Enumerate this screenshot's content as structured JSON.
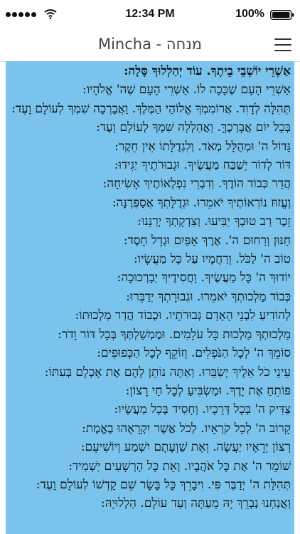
{
  "status_bar": {
    "time": "12:34 PM",
    "battery": "100%"
  },
  "nav": {
    "title": "Mincha - מנחה"
  },
  "prayer": {
    "lines": [
      "אַשְׁרֵי יוֹשְׁבֵי בֵיתֶךָ. עוֹד יְהַלְלוּךָ סֶּלָה:",
      "אַשְׁרֵי הָעָם שֶׁכָּכָה לוֹ. אַשְׁרֵי הָעָם שֶׁה' אֱלֹהָיו:",
      "תְּהִלָּה לְדָוִד. אֲרוֹמִמְךָ אֱלוֹהַי הַמֶּלֶךְ. וַאֲבָרְכָה שִׁמְךָ לְעוֹלָם וָעֶד:",
      "בְּכָל יוֹם אֲבָרְכֶךָּ. וַאֲהַלְלָה שִׁמְךָ לְעוֹלָם וָעֶד:",
      "גָּדוֹל ה' וּמְהֻלָּל מְאֹד. וְלִגְדֻלָּתוֹ אֵין חֵקֶר:",
      "דּוֹר לְדוֹר יְשַׁבַּח מַעֲשֶׂיךָ. וּגְבוּרֹתֶיךָ יַגִּידוּ:",
      "הֲדַר כְּבוֹד הוֹדֶךָ. וְדִבְרֵי נִפְלְאוֹתֶיךָ אָשִׂיחָה:",
      "וֶעֱזוּז נוֹרְאוֹתֶיךָ יֹאמֵרוּ. וּגְדֻלָּתְךָ אֲסַפְּרֶנָּה:",
      "זֵכֶר רַב טוּבְךָ יַבִּיעוּ. וְצִדְקָתְךָ יְרַנֵּנוּ:",
      "חַנּוּן וְרַחוּם ה'. אֶרֶךְ אַפַּיִם וּגְדָל חָסֶד:",
      "טוֹב ה' לַכֹּל. וְרַחֲמָיו עַל כָּל מַעֲשָׂיו:",
      "יוֹדוּךָ ה' כָּל מַעֲשֶׂיךָ. וַחֲסִידֶיךָ יְבָרְכוּכָה:",
      "כְּבוֹד מַלְכוּתְךָ יֹאמֵרוּ. וּגְבוּרָתְךָ יְדַבֵּרוּ:",
      "לְהוֹדִיעַ לִבְנֵי הָאָדָם גְּבוּרֹתָיו. וּכְבוֹד הֲדַר מַלְכוּתוֹ:",
      "מַלְכוּתְךָ מַלְכוּת כָּל עֹלָמִים. וּמֶמְשַׁלְתְּךָ בְּכָל דּוֹר וָדֹר:",
      "סוֹמֵךְ ה' לְכָל הַנֹּפְלִים. וְזוֹקֵף לְכָל הַכְּפוּפִים:",
      "עֵינֵי כֹל אֵלֶיךָ יְשַׂבֵּרוּ. וְאַתָּה נוֹתֵן לָהֶם אֶת אָכְלָם בְּעִתּוֹ:",
      "פּוֹתֵחַ אֶת יָדֶךָ. וּמַשְׂבִּיעַ לְכָל חַי רָצוֹן:",
      "צַדִּיק ה' בְּכָל דְּרָכָיו. וְחָסִיד בְּכָל מַעֲשָׂיו:",
      "קָרוֹב ה' לְכָל קֹרְאָיו. לְכֹל אֲשֶׁר יִקְרָאֻהוּ בֶאֱמֶת:",
      "רְצוֹן יְרֵאָיו יַעֲשֶׂה. וְאֶת שַׁוְעָתָם יִשְׁמַע וְיוֹשִׁיעֵם:",
      "שׁוֹמֵר ה' אֶת כָּל אֹהֲבָיו. וְאֵת כָּל הָרְשָׁעִים יַשְׁמִיד:",
      "תְּהִלַּת ה' יְדַבֶּר פִּי. וִיבָרֵךְ כָּל בָּשָׂר שֵׁם קָדְשׁוֹ לְעוֹלָם וָעֶד:",
      "וַאֲנַחְנוּ נְבָרֵךְ יָהּ מֵעַתָּה וְעַד עוֹלָם. הַלְלוּיָהּ:"
    ]
  },
  "icons": {
    "signal": "signal-dots-icon",
    "wifi": "wifi-icon",
    "battery": "battery-icon",
    "menu": "hamburger-menu-icon"
  },
  "colors": {
    "content_background": "#79c3ec",
    "text": "#111111"
  }
}
